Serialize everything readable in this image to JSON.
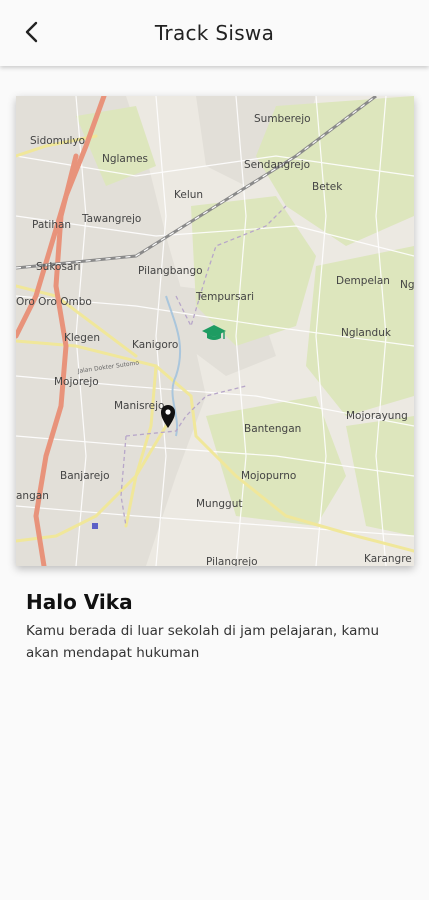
{
  "header": {
    "title": "Track Siswa",
    "back_icon": "back-arrow-icon"
  },
  "map": {
    "places": [
      {
        "name": "Sidomulyo"
      },
      {
        "name": "Sumberejo"
      },
      {
        "name": "Nglames"
      },
      {
        "name": "Sendangrejo"
      },
      {
        "name": "Kelun"
      },
      {
        "name": "Betek"
      },
      {
        "name": "Patihan"
      },
      {
        "name": "Tawangrejo"
      },
      {
        "name": "Sukosari"
      },
      {
        "name": "Pilangbango"
      },
      {
        "name": "Dempelan"
      },
      {
        "name": "Ng"
      },
      {
        "name": "Oro Oro Ombo"
      },
      {
        "name": "Tempursari"
      },
      {
        "name": "Klegen"
      },
      {
        "name": "Kanigoro"
      },
      {
        "name": "Nglanduk"
      },
      {
        "name": "Mojorejo"
      },
      {
        "name": "Manisrejo"
      },
      {
        "name": "Mojorayung"
      },
      {
        "name": "Bantengan"
      },
      {
        "name": "Banjarejo"
      },
      {
        "name": "Mojopurno"
      },
      {
        "name": "angan"
      },
      {
        "name": "Munggut"
      },
      {
        "name": "Karangre"
      },
      {
        "name": "Pilangrejo"
      }
    ],
    "road_label": "Jalan Dokter Sutomo",
    "school_icon": "graduation-cap-icon",
    "location_icon": "location-pin-icon"
  },
  "status": {
    "greeting": "Halo Vika",
    "message": "Kamu berada di luar sekolah di jam pelajaran, kamu akan mendapat hukuman"
  },
  "colors": {
    "background": "#fafafa",
    "major_road": "#e8957e",
    "secondary_road": "#f2eaa0",
    "railway": "#8a8a8a",
    "green_area": "#d9e4b8",
    "school_marker": "#1e9c62",
    "pin": "#111111"
  }
}
